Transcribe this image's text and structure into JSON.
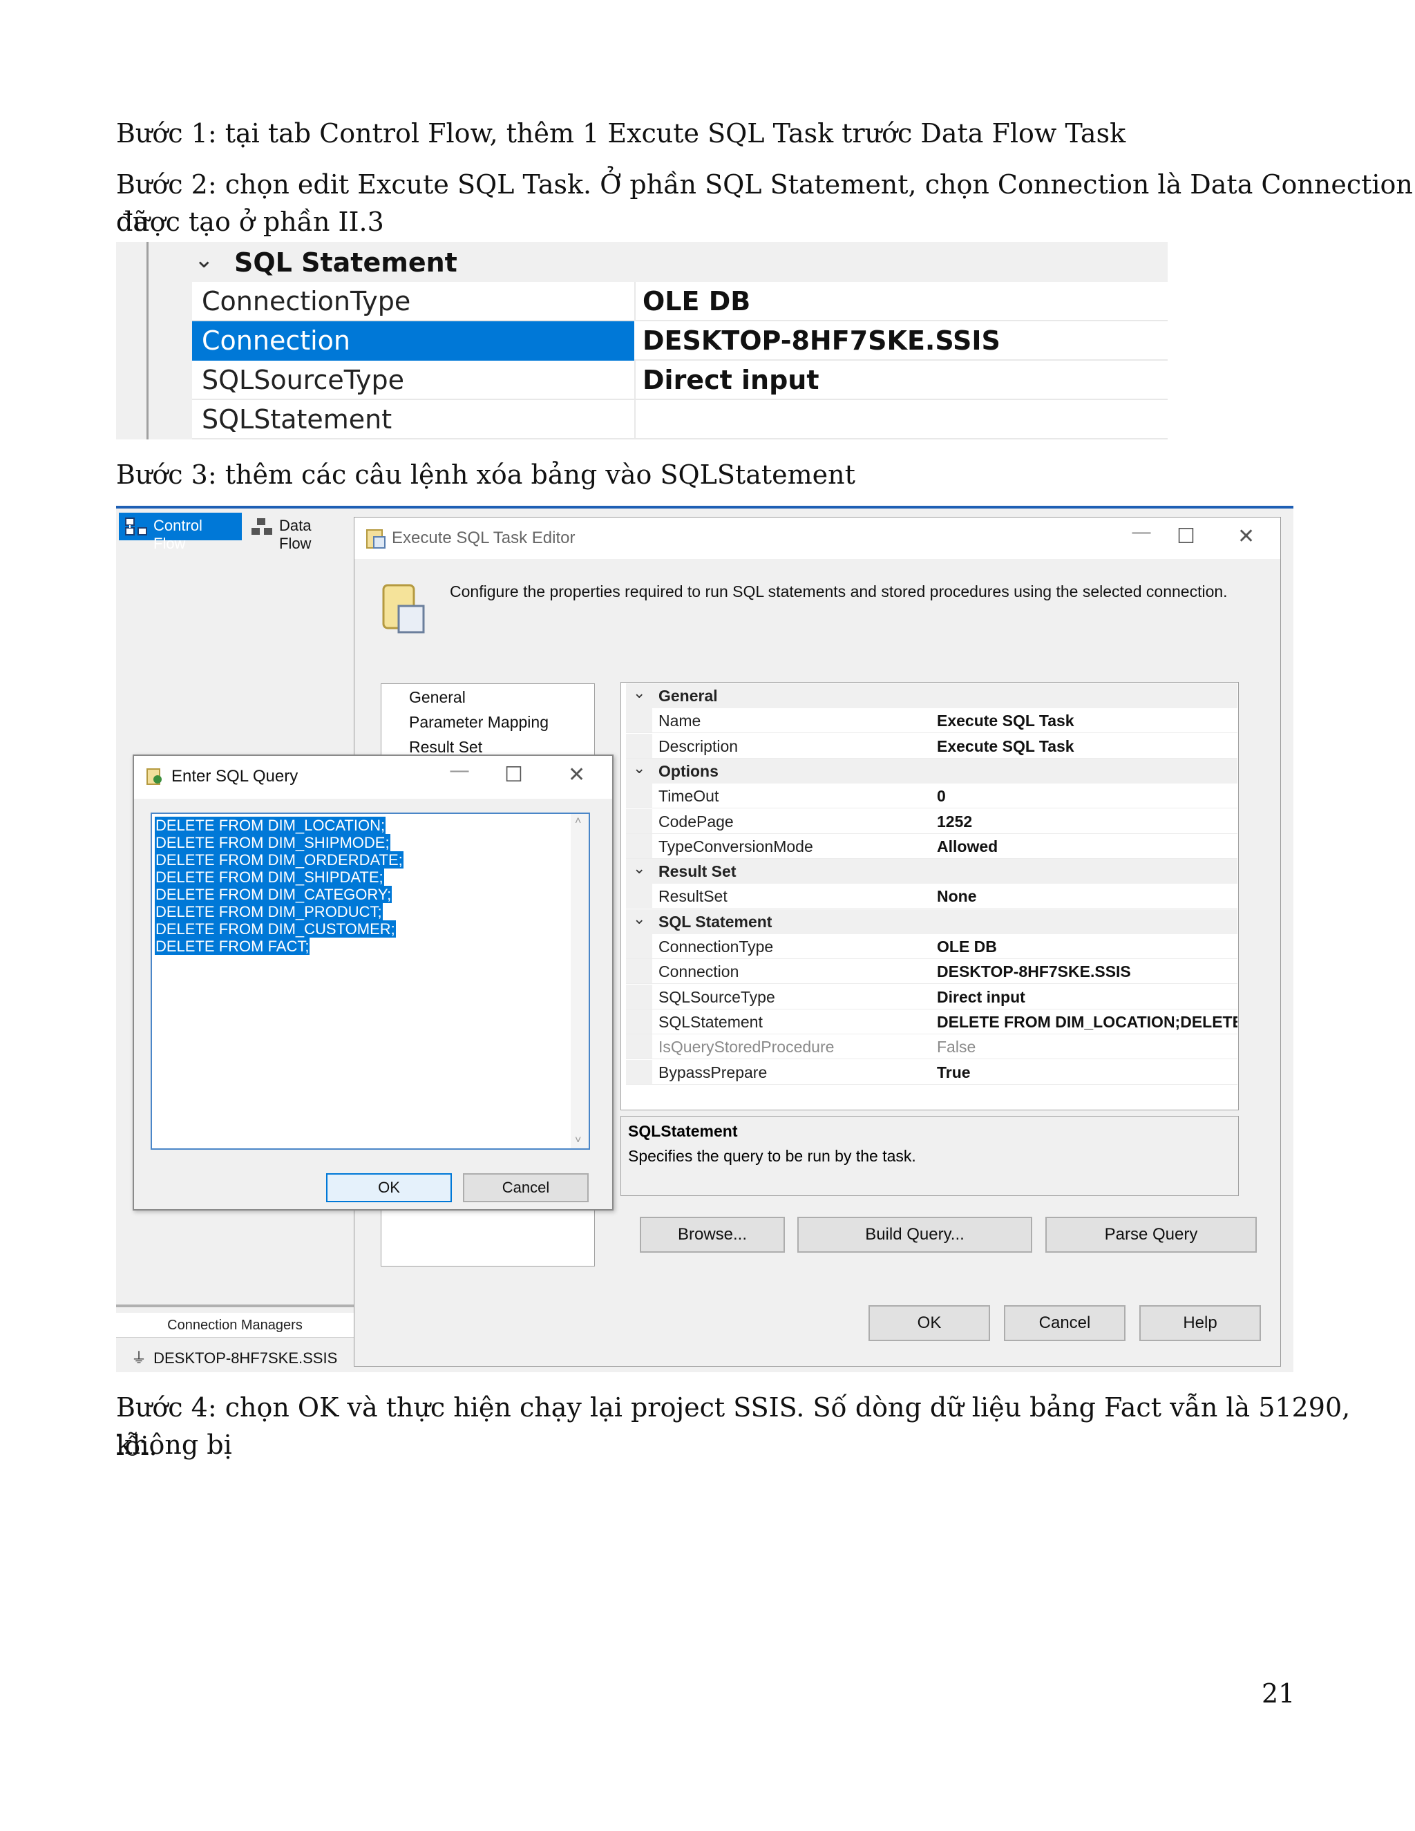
{
  "paragraphs": {
    "step1": "Bước 1: tại tab Control Flow, thêm 1 Excute SQL Task trước Data Flow Task",
    "step2_line1": "Bước 2: chọn edit Excute SQL Task. Ở phần SQL Statement, chọn Connection là Data Connection đã",
    "step2_line2": "được tạo ở phần II.3",
    "step3": "Bước 3: thêm các câu lệnh xóa bảng vào SQLStatement",
    "step4_line1": "Bước 4: chọn OK và thực hiện chạy lại project SSIS. Số dòng dữ liệu bảng Fact vẫn là 51290, không bị",
    "step4_line2": "lỗi."
  },
  "page_number": "21",
  "shot1": {
    "category": "SQL Statement",
    "rows": [
      {
        "name": "ConnectionType",
        "value": "OLE DB"
      },
      {
        "name": "Connection",
        "value": "DESKTOP-8HF7SKE.SSIS"
      },
      {
        "name": "SQLSourceType",
        "value": "Direct input"
      },
      {
        "name": "SQLStatement",
        "value": ""
      }
    ]
  },
  "shot2": {
    "tabs": {
      "control_flow": "Control Flow",
      "data_flow": "Data Flow"
    },
    "editor": {
      "title": "Execute SQL Task Editor",
      "description": "Configure the properties required to run SQL statements and stored procedures using the selected connection.",
      "nav": [
        "General",
        "Parameter Mapping",
        "Result Set"
      ],
      "grid": [
        {
          "type": "cat",
          "name": "General"
        },
        {
          "type": "row",
          "name": "Name",
          "value": "Execute SQL Task"
        },
        {
          "type": "row",
          "name": "Description",
          "value": "Execute SQL Task"
        },
        {
          "type": "cat",
          "name": "Options"
        },
        {
          "type": "row",
          "name": "TimeOut",
          "value": "0"
        },
        {
          "type": "row",
          "name": "CodePage",
          "value": "1252"
        },
        {
          "type": "row",
          "name": "TypeConversionMode",
          "value": "Allowed"
        },
        {
          "type": "cat",
          "name": "Result Set"
        },
        {
          "type": "row",
          "name": "ResultSet",
          "value": "None"
        },
        {
          "type": "cat",
          "name": "SQL Statement"
        },
        {
          "type": "row",
          "name": "ConnectionType",
          "value": "OLE DB"
        },
        {
          "type": "row",
          "name": "Connection",
          "value": "DESKTOP-8HF7SKE.SSIS"
        },
        {
          "type": "row",
          "name": "SQLSourceType",
          "value": "Direct input"
        },
        {
          "type": "row",
          "name": "SQLStatement",
          "value": "DELETE FROM DIM_LOCATION;DELETE FRO"
        },
        {
          "type": "row",
          "name": "IsQueryStoredProcedure",
          "value": "False",
          "disabled": true
        },
        {
          "type": "row",
          "name": "BypassPrepare",
          "value": "True"
        }
      ],
      "help_title": "SQLStatement",
      "help_text": "Specifies the query to be run by the task.",
      "browse": "Browse...",
      "build_query": "Build Query...",
      "parse_query": "Parse Query",
      "ok": "OK",
      "cancel": "Cancel",
      "help": "Help"
    },
    "sql_dialog": {
      "title": "Enter SQL Query",
      "lines": [
        "DELETE FROM DIM_LOCATION;",
        "DELETE FROM DIM_SHIPMODE;",
        "DELETE FROM DIM_ORDERDATE;",
        "DELETE FROM DIM_SHIPDATE;",
        "DELETE FROM DIM_CATEGORY;",
        "DELETE FROM DIM_PRODUCT;",
        "DELETE FROM DIM_CUSTOMER;",
        "DELETE FROM FACT;"
      ],
      "ok": "OK",
      "cancel": "Cancel"
    },
    "connection_managers": {
      "label": "Connection Managers",
      "item": "DESKTOP-8HF7SKE.SSIS"
    }
  }
}
